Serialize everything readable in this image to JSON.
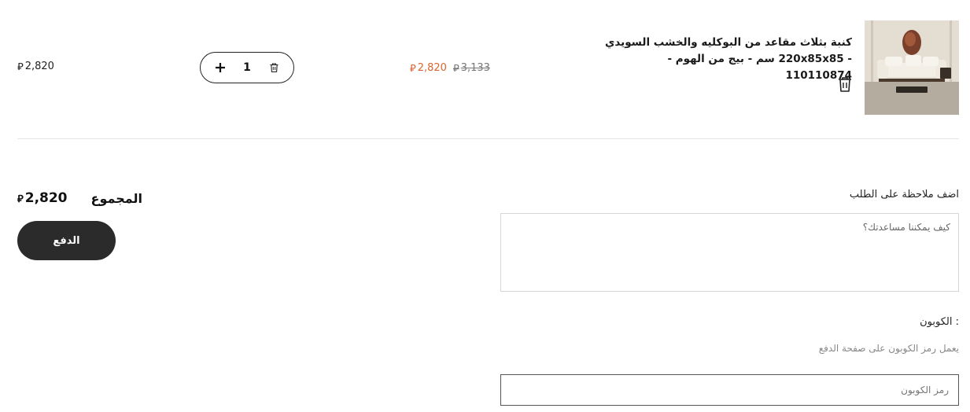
{
  "cart_item": {
    "image_alt": "sofa-photo",
    "title": "كنبة بثلاث مقاعد من البوكليه والخشب السويدي - 220x85x85 سم - بيج من الهوم - 110110874",
    "price_sale": "2,820",
    "price_original": "3,133",
    "currency_symbol": "⃁",
    "quantity": "1",
    "line_total": "2,820",
    "sale_color": "#d9642f"
  },
  "summary": {
    "total_label": "المجموع",
    "total_amount": "2,820",
    "checkout_label": "الدفع"
  },
  "order_note": {
    "label": "اضف ملاحظة على الطلب",
    "placeholder": "كيف يمكننا مساعدتك؟"
  },
  "coupon": {
    "label": ": الكوبون",
    "hint": "يعمل رمز الكوبون على صفحة الدفع",
    "placeholder": "رمز الكوبون"
  },
  "icons": {
    "remove": "trash-icon",
    "increase": "plus-icon",
    "decrease": "trash-small-icon"
  }
}
